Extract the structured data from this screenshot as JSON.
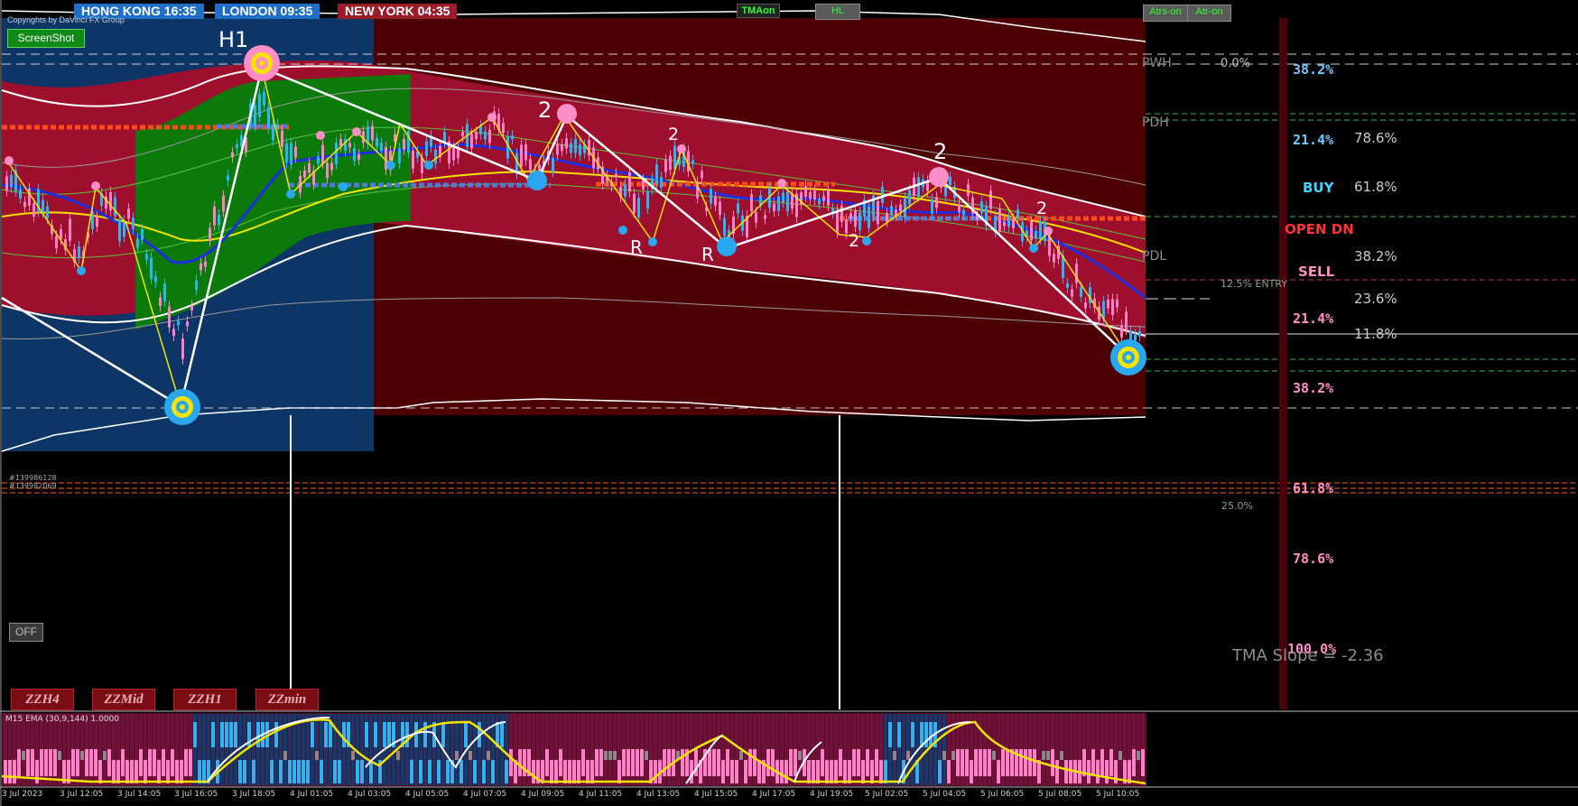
{
  "sessions": {
    "hongkong": "HONG KONG 16:35",
    "london": "LONDON  09:35",
    "newyork": "NEW YORK  04:35"
  },
  "copyright": "Copyrights by DaVinci FX Group",
  "buttons": {
    "screenshot": "ScreenShot",
    "tma_on": "TMAon",
    "hl": "HL",
    "atrs_on": "Atrs-on",
    "atr_on": "Atr-on",
    "off": "OFF",
    "zz": [
      "ZZH4",
      "ZZMid",
      "ZZH1",
      "ZZmin"
    ]
  },
  "levels": {
    "pwh": "PWH",
    "pdh": "PDH",
    "pdl": "PDL",
    "pct_0": "0.0%",
    "entry": "12.5% ENTRY",
    "pct_25": "25.0%"
  },
  "signals": {
    "buy": "BUY",
    "open": "OPEN  DN",
    "sell": "SELL"
  },
  "fib_left": [
    "38.2%",
    "21.4%",
    "21.4%",
    "38.2%",
    "61.8%",
    "78.6%",
    "100.0%"
  ],
  "fib_right": [
    "78.6%",
    "61.8%",
    "38.2%",
    "23.6%",
    "11.8%"
  ],
  "tma_slope": "TMA Slope = -2.36",
  "wave_labels": {
    "h1": "H1",
    "two": "2",
    "r": "R"
  },
  "order_ids": [
    "#139986128",
    "#139982069"
  ],
  "indicator": {
    "title": "M15 EMA (30,9,144) 1.0000"
  },
  "x_axis": [
    "3 Jul 2023",
    "3 Jul 12:05",
    "3 Jul 14:05",
    "3 Jul 16:05",
    "3 Jul 18:05",
    "4 Jul 01:05",
    "4 Jul 03:05",
    "4 Jul 05:05",
    "4 Jul 07:05",
    "4 Jul 09:05",
    "4 Jul 11:05",
    "4 Jul 13:05",
    "4 Jul 15:05",
    "4 Jul 17:05",
    "4 Jul 19:05",
    "5 Jul 02:05",
    "5 Jul 04:05",
    "5 Jul 06:05",
    "5 Jul 08:05",
    "5 Jul 10:05"
  ],
  "colors": {
    "bull": "#29b6f6",
    "bear": "#ff7fc8",
    "band_red": "#9e0f2e",
    "band_dark": "#4c0004",
    "band_green": "#0b7a0b",
    "band_blue": "#0d3566"
  }
}
